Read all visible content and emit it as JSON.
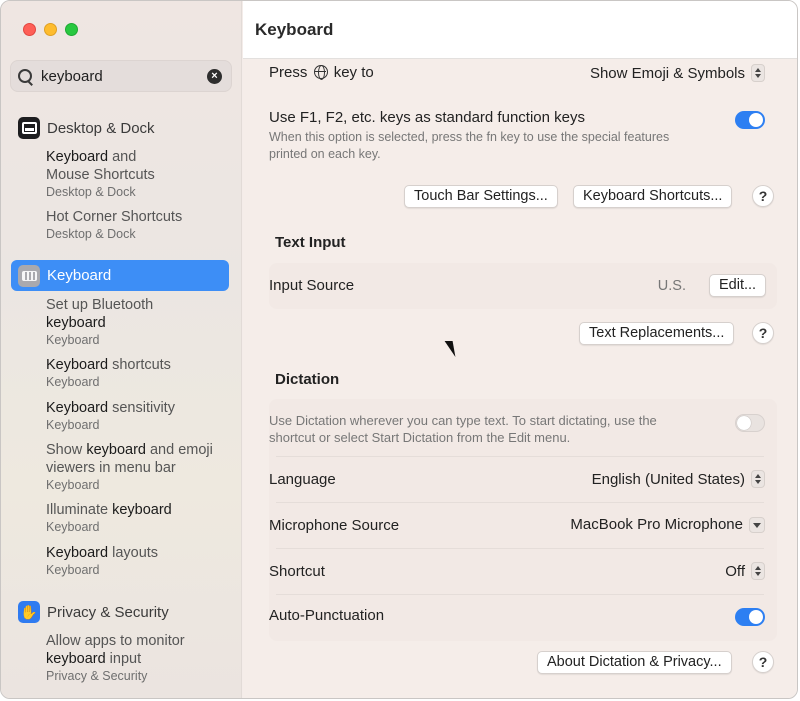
{
  "window": {
    "title": "Keyboard"
  },
  "search": {
    "query": "keyboard",
    "clear_icon": "clear-circle-icon"
  },
  "sidebar": {
    "desktop_dock": {
      "label": "Desktop & Dock",
      "items": [
        {
          "pre": "",
          "bold": "Keyboard",
          "post": " and",
          "line2": "Mouse Shortcuts",
          "sub": "Desktop & Dock"
        },
        {
          "pre": "Hot Corner Shortcuts",
          "bold": "",
          "post": "",
          "line2": "",
          "sub": "Desktop & Dock"
        }
      ]
    },
    "keyboard": {
      "label": "Keyboard",
      "items": [
        {
          "line1": "Set up Bluetooth",
          "bold": "keyboard",
          "sub": "Keyboard"
        },
        {
          "bold": "Keyboard",
          "post": " shortcuts",
          "sub": "Keyboard"
        },
        {
          "bold": "Keyboard",
          "post": " sensitivity",
          "sub": "Keyboard"
        },
        {
          "pre": "Show ",
          "bold": "keyboard",
          "post": " and emoji",
          "line2": "viewers in menu bar",
          "sub": "Keyboard"
        },
        {
          "pre": "Illuminate ",
          "bold": "keyboard",
          "sub": "Keyboard"
        },
        {
          "bold": "Keyboard",
          "post": " layouts",
          "sub": "Keyboard"
        }
      ]
    },
    "privacy": {
      "label": "Privacy & Security",
      "items": [
        {
          "line1": "Allow apps to monitor",
          "bold": "keyboard",
          "post": " input",
          "sub": "Privacy & Security"
        }
      ]
    }
  },
  "main": {
    "press_key": {
      "label_pre": "Press",
      "label_post": "key to",
      "value": "Show Emoji & Symbols"
    },
    "fn_keys": {
      "label": "Use F1, F2, etc. keys as standard function keys",
      "desc_line1": "When this option is selected, press the fn key to use the special features",
      "desc_line2": "printed on each key.",
      "enabled": true
    },
    "buttons": {
      "touch_bar": "Touch Bar Settings...",
      "kbd_shortcuts": "Keyboard Shortcuts...",
      "help": "?"
    },
    "text_input": {
      "title": "Text Input",
      "input_source_label": "Input Source",
      "input_source_value": "U.S.",
      "edit": "Edit...",
      "text_replacements": "Text Replacements..."
    },
    "dictation": {
      "title": "Dictation",
      "desc_line1": "Use Dictation wherever you can type text. To start dictating, use the",
      "desc_line2": "shortcut or select Start Dictation from the Edit menu.",
      "enabled": false,
      "language_label": "Language",
      "language_value": "English (United States)",
      "mic_label": "Microphone Source",
      "mic_value": "MacBook Pro Microphone",
      "shortcut_label": "Shortcut",
      "shortcut_value": "Off",
      "autopunct_label": "Auto-Punctuation",
      "autopunct_enabled": true,
      "about": "About Dictation & Privacy..."
    }
  },
  "colors": {
    "accent": "#3d8ef6",
    "toggle_on": "#2d7ff2"
  }
}
